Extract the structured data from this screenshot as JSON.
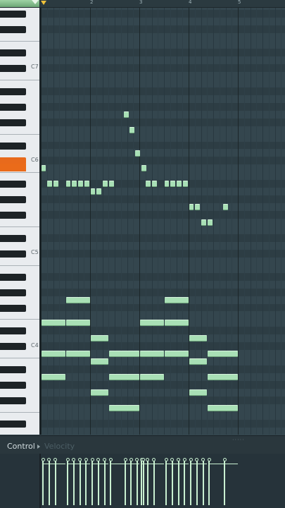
{
  "ruler": {
    "bars": [
      "2",
      "3",
      "4",
      "5"
    ]
  },
  "keyboard": {
    "octave_labels": [
      "C7",
      "C6",
      "C5",
      "C4"
    ]
  },
  "control": {
    "label": "Control",
    "value": "Velocity"
  },
  "colors": {
    "note": "#a9e0b6",
    "active_key": "#ea6b1a",
    "grid": "#34464e"
  }
}
